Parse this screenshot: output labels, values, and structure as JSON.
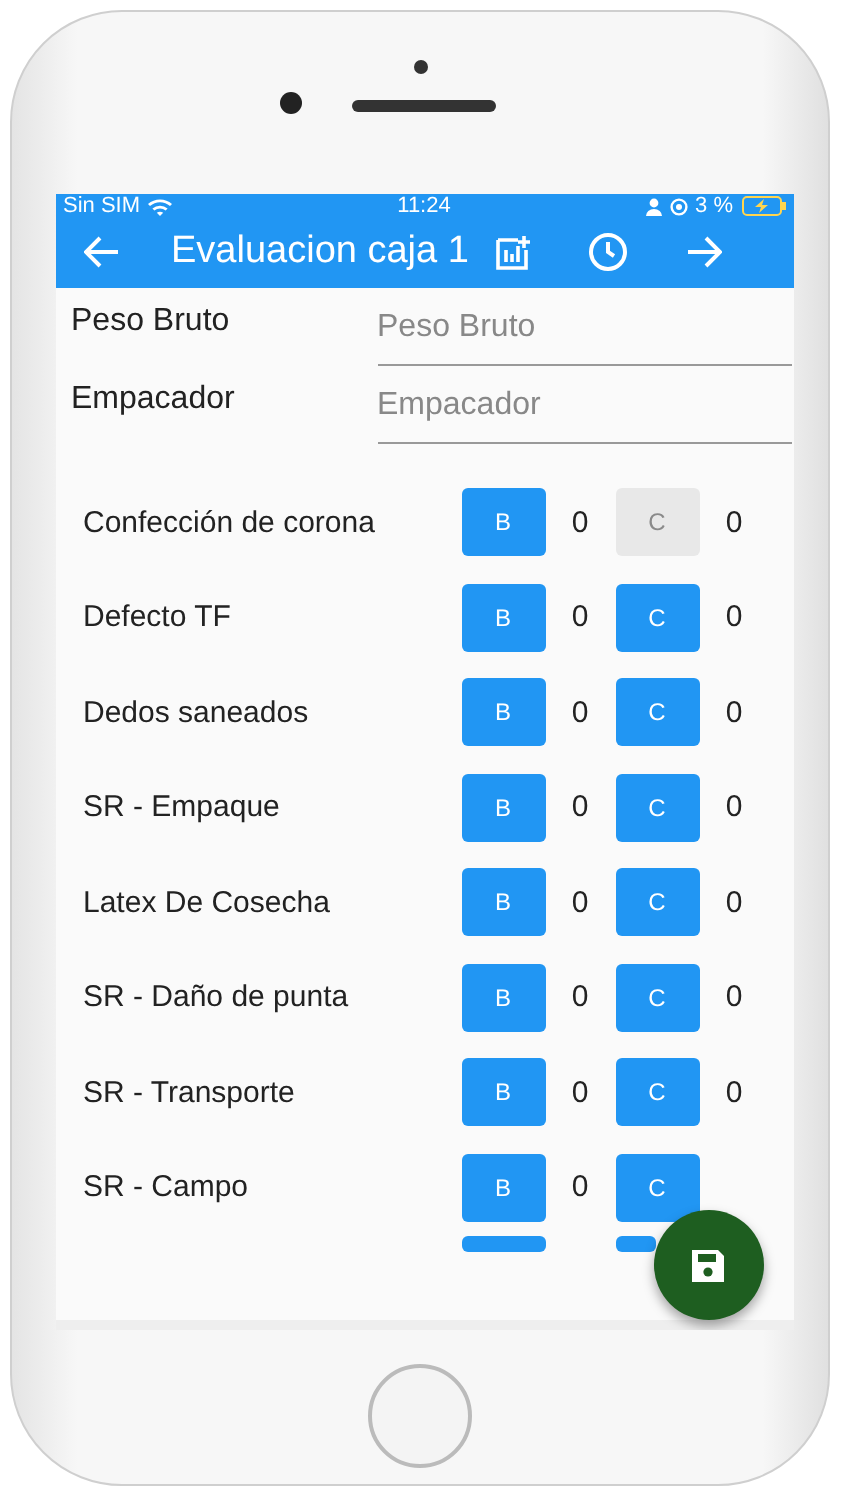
{
  "status_bar": {
    "carrier": "Sin SIM",
    "time": "11:24",
    "battery": "3 %"
  },
  "app_bar": {
    "title": "Evaluacion caja 1"
  },
  "fields": [
    {
      "label": "Peso Bruto",
      "placeholder": "Peso Bruto"
    },
    {
      "label": "Empacador",
      "placeholder": "Empacador"
    }
  ],
  "rows": [
    {
      "kind": "full",
      "label": "Confección de corona",
      "b_label": "B",
      "b_count": "0",
      "c_label": "C",
      "c_count": "0",
      "c_disabled": true
    },
    {
      "kind": "full",
      "label": "Defecto TF",
      "b_label": "B",
      "b_count": "0",
      "c_label": "C",
      "c_count": "0",
      "c_disabled": false
    },
    {
      "kind": "full",
      "label": "Dedos saneados",
      "b_label": "B",
      "b_count": "0",
      "c_label": "C",
      "c_count": "0",
      "c_disabled": false
    },
    {
      "kind": "full",
      "label": "SR - Empaque",
      "b_label": "B",
      "b_count": "0",
      "c_label": "C",
      "c_count": "0",
      "c_disabled": false
    },
    {
      "kind": "full",
      "label": "Latex De Cosecha",
      "b_label": "B",
      "b_count": "0",
      "c_label": "C",
      "c_count": "0",
      "c_disabled": false
    },
    {
      "kind": "full",
      "label": "SR - Daño de punta",
      "b_label": "B",
      "b_count": "0",
      "c_label": "C",
      "c_count": "0",
      "c_disabled": false
    },
    {
      "kind": "full",
      "label": "SR - Transporte",
      "b_label": "B",
      "b_count": "0",
      "c_label": "C",
      "c_count": "0",
      "c_disabled": false
    },
    {
      "kind": "full",
      "label": "SR - Campo",
      "b_label": "B",
      "b_count": "0",
      "c_label": "C",
      "c_disabled": false
    },
    {
      "kind": "cut"
    }
  ]
}
